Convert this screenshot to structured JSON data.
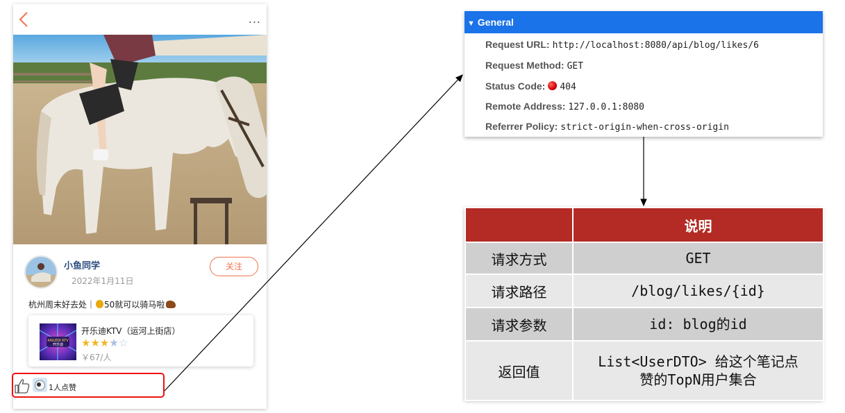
{
  "app": {
    "more_label": "...",
    "author_name": "小鱼同学",
    "post_date": "2022年1月11日",
    "follow_label": "关注",
    "post_text_part1": "杭州周末好去处｜",
    "post_text_part2": "50就可以骑马啦",
    "shop": {
      "name": "开乐迪KTV（运河上街店）",
      "rating": 3.5,
      "max_rating": 5,
      "price": "￥67/人",
      "logo_text_top": "KAILEDI KTV",
      "logo_text_bottom": "开乐迪"
    },
    "like_count": "1人点赞"
  },
  "devtools": {
    "section_title": "General",
    "rows": [
      {
        "key": "Request URL:",
        "value": "http://localhost:8080/api/blog/likes/6"
      },
      {
        "key": "Request Method:",
        "value": "GET"
      },
      {
        "key": "Status Code:",
        "value": "404"
      },
      {
        "key": "Remote Address:",
        "value": "127.0.0.1:8080"
      },
      {
        "key": "Referrer Policy:",
        "value": "strict-origin-when-cross-origin"
      }
    ],
    "status_color": "#d20000"
  },
  "spec_table": {
    "header_empty": "",
    "header": "说明",
    "rows": [
      {
        "label": "请求方式",
        "value": "GET"
      },
      {
        "label": "请求路径",
        "value": "/blog/likes/{id}"
      },
      {
        "label": "请求参数",
        "value": "id: blog的id"
      },
      {
        "label": "返回值",
        "value_line1": "List<UserDTO> 给这个笔记点",
        "value_line2": "赞的TopN用户集合"
      }
    ],
    "header_color": "#b32b24"
  },
  "colors": {
    "accent": "#f0734f",
    "highlight_border": "#e11111",
    "devtools_blue": "#1a73e8"
  }
}
